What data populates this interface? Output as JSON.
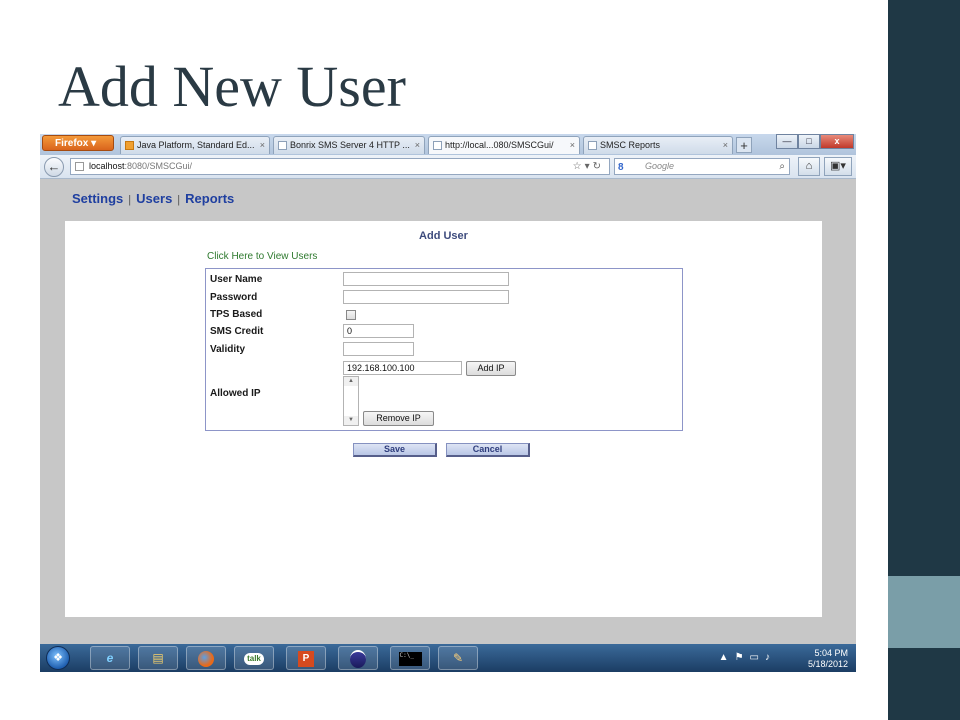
{
  "slide": {
    "title": "Add New User"
  },
  "browser": {
    "firefox_label": "Firefox",
    "tabs": [
      {
        "label": "Java Platform, Standard Ed...",
        "active": false
      },
      {
        "label": "Bonrix SMS Server 4 HTTP ...",
        "active": false
      },
      {
        "label": "http://local...080/SMSCGui/",
        "active": true
      },
      {
        "label": "SMSC Reports",
        "active": false
      }
    ],
    "new_tab": "+",
    "address": {
      "host": "localhost",
      "rest": ":8080/SMSCGui/"
    },
    "search_placeholder": "Google",
    "search_engine_glyph": "8",
    "window_buttons": {
      "minimize": "—",
      "maximize": "□",
      "close": "x"
    }
  },
  "app": {
    "nav": [
      "Settings",
      "Users",
      "Reports"
    ],
    "form": {
      "title": "Add User",
      "view_users_link": "Click Here to View Users",
      "fields": {
        "user_name": {
          "label": "User Name",
          "value": ""
        },
        "password": {
          "label": "Password",
          "value": ""
        },
        "tps_based": {
          "label": "TPS Based",
          "checked": false
        },
        "sms_credit": {
          "label": "SMS Credit",
          "value": "0"
        },
        "validity": {
          "label": "Validity",
          "value": ""
        },
        "allowed_ip": {
          "label": "Allowed IP",
          "value": "192.168.100.100",
          "list": []
        }
      },
      "add_ip_button": "Add IP",
      "remove_ip_button": "Remove IP",
      "save_button": "Save",
      "cancel_button": "Cancel"
    }
  },
  "taskbar": {
    "apps": [
      "ie-icon",
      "explorer-icon",
      "firefox-icon",
      "talk-icon",
      "powerpoint-icon",
      "eclipse-icon",
      "terminal-icon",
      "paint-icon"
    ],
    "talk_label": "talk",
    "terminal_label": "C:\\_",
    "time": "5:04 PM",
    "date": "5/18/2012"
  }
}
